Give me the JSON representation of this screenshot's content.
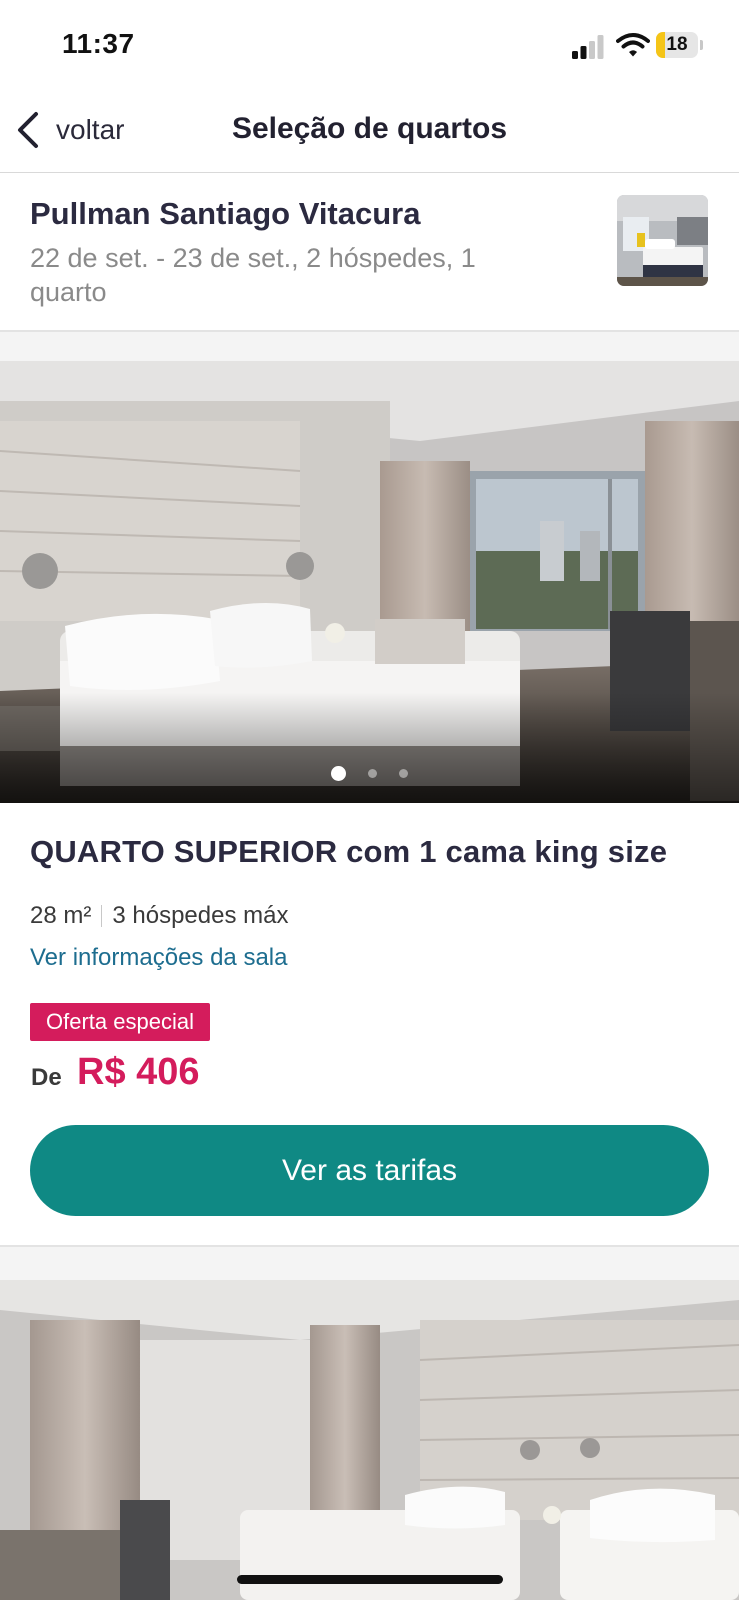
{
  "status_bar": {
    "time": "11:37",
    "battery": "18"
  },
  "header": {
    "back_label": "voltar",
    "title": "Seleção de quartos"
  },
  "hotel": {
    "name": "Pullman Santiago Vitacura",
    "details": "22 de set. - 23 de set., 2 hóspedes, 1 quarto",
    "thumbnail_icon": "hotel-room-thumbnail"
  },
  "room": {
    "name": "QUARTO SUPERIOR com 1 cama king size",
    "size": "28 m²",
    "guests": "3 hóspedes máx",
    "info_link": "Ver informações da sala",
    "badge": "Oferta especial",
    "price_prefix": "De",
    "price": "R$ 406",
    "cta": "Ver as tarifas",
    "carousel": {
      "total": 3,
      "active": 1
    }
  },
  "colors": {
    "accent_teal": "#0f8984",
    "offer_pink": "#d41c5c",
    "link_blue": "#1d6d8f",
    "battery_low": "#f5c518"
  }
}
